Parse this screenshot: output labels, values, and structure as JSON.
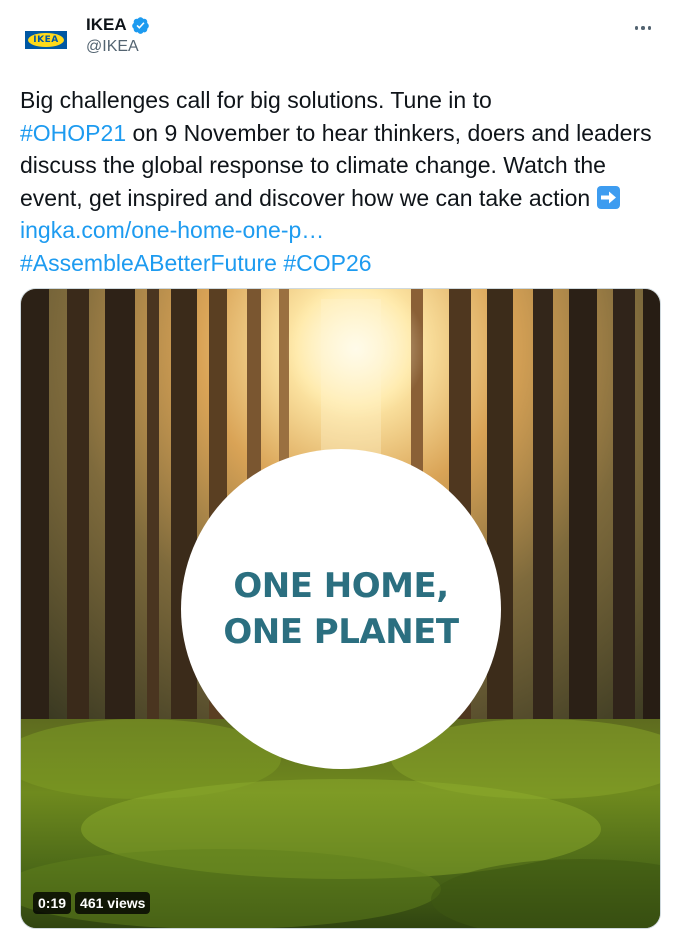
{
  "author": {
    "display_name": "IKEA",
    "handle": "@IKEA",
    "verified": true,
    "avatar_logo_text": "IKEA",
    "avatar_icon": "ikea-logo-icon"
  },
  "more_icon": "more-options-icon",
  "tweet": {
    "line1": "Big challenges call for big solutions. Tune in to",
    "hashtag_ohop": "#OHOP21",
    "text_after_hashtag": " on 9 November to hear thinkers, doers and leaders discuss the global response to climate change. Watch the event, get inspired and discover how we can take action ",
    "arrow_icon": "right-arrow-emoji-icon",
    "link_text": "ingka.com/one-home-one-p…",
    "hashtag_assemble": "#AssembleABetterFuture",
    "hashtag_cop": "#COP26"
  },
  "media": {
    "badge_line1": "ONE HOME,",
    "badge_line2": "ONE PLANET",
    "duration": "0:19",
    "views": "461 views"
  },
  "colors": {
    "link": "#1d9bf0",
    "badge_text": "#2b6f80",
    "ikea_blue": "#0058a3",
    "ikea_yellow": "#ffda1a",
    "verified_blue": "#1d9bf0"
  }
}
